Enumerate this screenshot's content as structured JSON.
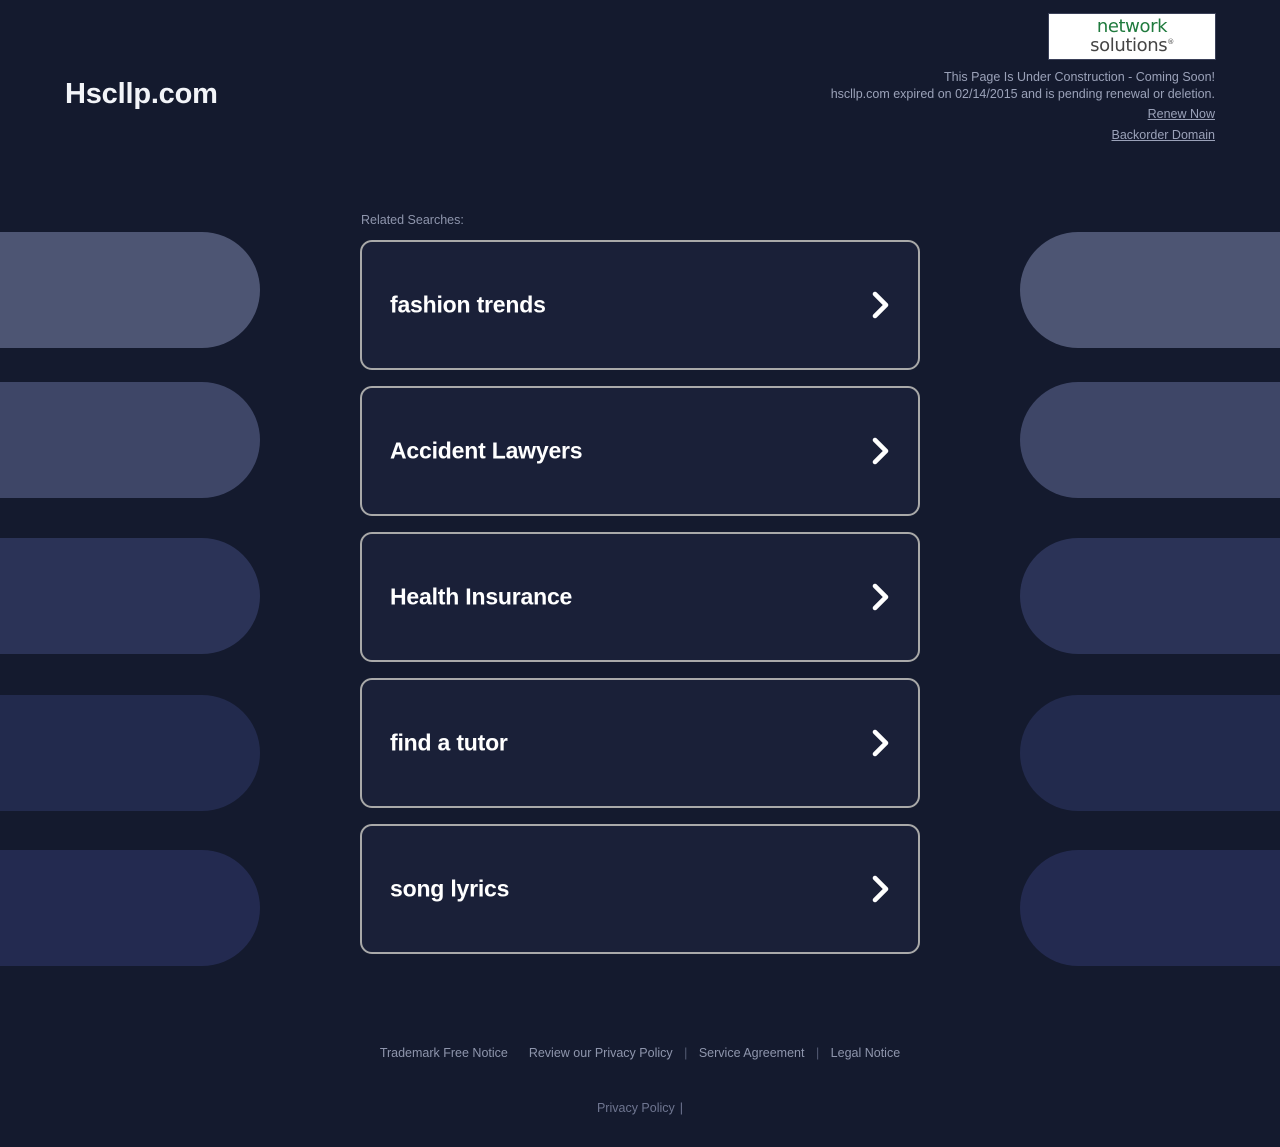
{
  "page": {
    "background_color": "#141a2e",
    "card_background_color": "#1a2038",
    "card_border_color": "#a9a9a9",
    "accent_green": "#1f7a3d"
  },
  "header": {
    "domain_title": "Hscllp.com",
    "logo": {
      "name": "network-solutions-logo",
      "word_one": "network",
      "word_two": "solutions",
      "registered_mark": "®"
    },
    "notice_line_1": "This Page Is Under Construction - Coming Soon!",
    "notice_line_2": "hscllp.com expired on 02/14/2015 and is pending renewal or deletion.",
    "links": [
      {
        "label": "Renew Now",
        "name": "renew-now-link"
      },
      {
        "label": "Backorder Domain",
        "name": "backorder-domain-link"
      }
    ]
  },
  "main": {
    "related_label": "Related Searches:",
    "chevron_icon": "chevron-right-icon",
    "cards": [
      {
        "label": "fashion trends"
      },
      {
        "label": "Accident Lawyers"
      },
      {
        "label": "Health Insurance"
      },
      {
        "label": "find a tutor"
      },
      {
        "label": "song lyrics"
      }
    ]
  },
  "decor": {
    "pill_colors_left": [
      "#4d5573",
      "#3e4667",
      "#2b3357",
      "#222a4d",
      "#232a50"
    ],
    "pill_colors_right": [
      "#4d5573",
      "#3e4667",
      "#2b3357",
      "#222a4d",
      "#232a50"
    ]
  },
  "footer": {
    "primary_links": [
      {
        "label": "Trademark Free Notice"
      },
      {
        "label": "Review our Privacy Policy"
      },
      {
        "label": "Service Agreement"
      },
      {
        "label": "Legal Notice"
      }
    ],
    "separator": "|",
    "secondary_link": "Privacy Policy",
    "secondary_trailing": "|"
  }
}
